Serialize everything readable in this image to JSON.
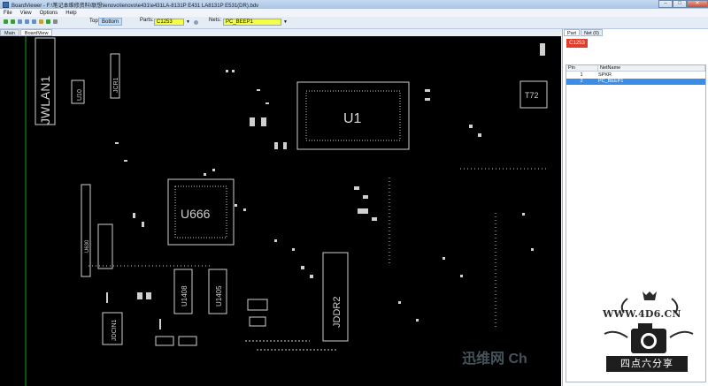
{
  "window": {
    "title": "BoardViewer - F:\\笔记本维修资料\\联想\\lenovo\\lenovo\\e431\\e431LA-8131P E431 LA8131P E531(DR).bdv",
    "controls": [
      "–",
      "□",
      "✕"
    ]
  },
  "menu": [
    "File",
    "View",
    "Options",
    "Help"
  ],
  "toolbar": {
    "top_label": "Top",
    "bottom_label": "Bottom",
    "parts_label": "Parts:",
    "parts_value": "C1253",
    "nets_label": "Nets:",
    "nets_value": "PC_BEEP1"
  },
  "left_tabs": [
    "Main",
    "BoardView"
  ],
  "right_tabs": [
    "Part",
    "Net (0)"
  ],
  "selected_part": "C1253",
  "pin_table": {
    "columns": [
      "Pin",
      "NetName"
    ],
    "rows": [
      {
        "pin": "1",
        "net": "SPKR",
        "selected": false
      },
      {
        "pin": "2",
        "net": "PC_BEEP1",
        "selected": true
      }
    ]
  },
  "board_labels": {
    "jwlan": "JWLAN1",
    "u10": "U10",
    "jcr1": "JCR1",
    "u1": "U1",
    "t72": "T72",
    "u666": "U666",
    "u1408": "U1408",
    "u1405": "U1405",
    "jddr": "JDDR2",
    "jdcin": "JDCIN1",
    "left": "U630"
  },
  "brand": {
    "url": "WWW.4D6.CN",
    "name": "四点六分享"
  },
  "watermark": "迅维网 Ch",
  "colors": {
    "board_bg": "#000000",
    "component": "#d8d8d8",
    "highlight": "#f5ff4a",
    "selected_row": "#3b8ee8",
    "part_button": "#e43c2b"
  }
}
